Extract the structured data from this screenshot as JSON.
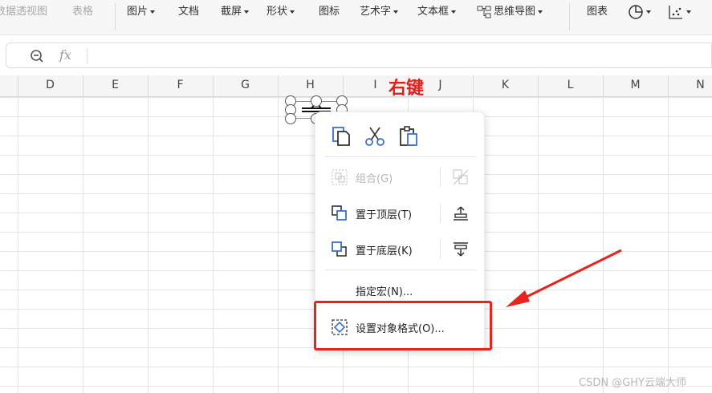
{
  "ribbon": {
    "items": [
      {
        "label": "数据透视图",
        "disabled": true
      },
      {
        "label": "表格",
        "disabled": true
      },
      {
        "label": "图片",
        "caret": true
      },
      {
        "label": "文档"
      },
      {
        "label": "截屏",
        "caret": true
      },
      {
        "label": "形状",
        "caret": true
      },
      {
        "label": "图标"
      },
      {
        "label": "艺术字",
        "caret": true
      },
      {
        "label": "文本框",
        "caret": true
      },
      {
        "label": "思维导图",
        "caret": true
      },
      {
        "label": "图表"
      }
    ]
  },
  "formula_bar": {
    "zoom_icon": "zoom-icon",
    "fx_label": "fx"
  },
  "columns": [
    "D",
    "E",
    "F",
    "G",
    "H",
    "I",
    "J",
    "K",
    "L",
    "M",
    "N"
  ],
  "annotation": {
    "label": "右键",
    "color": "#e0201b"
  },
  "context_menu": {
    "top_icons": [
      "copy-icon",
      "cut-icon",
      "paste-icon"
    ],
    "items": [
      {
        "label": "组合(G)",
        "icon": "group-icon",
        "side_icon": "ungroup-icon",
        "disabled": true
      },
      {
        "label": "置于顶层(T)",
        "icon": "bring-to-front-icon",
        "side_icon": "bring-forward-icon"
      },
      {
        "label": "置于底层(K)",
        "icon": "send-to-back-icon",
        "side_icon": "send-backward-icon"
      },
      {
        "label": "指定宏(N)..."
      },
      {
        "label": "设置对象格式(O)...",
        "icon": "format-object-icon"
      }
    ]
  },
  "watermark": "CSDN @GHY云端大师",
  "colors": {
    "accent": "#3b6fd1",
    "highlight": "#e8241d"
  }
}
